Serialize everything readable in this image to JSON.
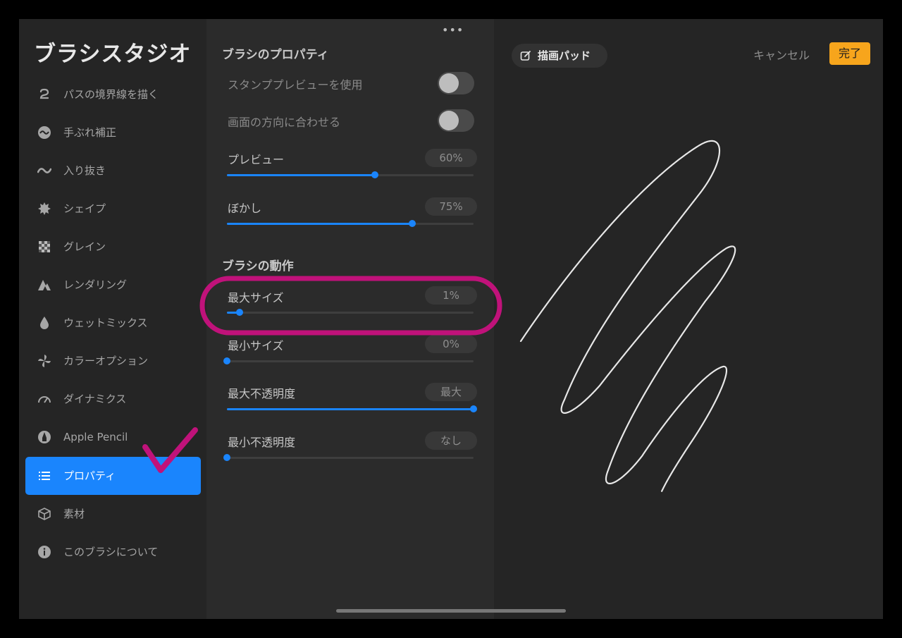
{
  "sidebar": {
    "title": "ブラシスタジオ",
    "items": [
      {
        "label": "パスの境界線を描く",
        "icon": "stroke-path-icon"
      },
      {
        "label": "手ぶれ補正",
        "icon": "stabilization-icon"
      },
      {
        "label": "入り抜き",
        "icon": "taper-icon"
      },
      {
        "label": "シェイプ",
        "icon": "shape-icon"
      },
      {
        "label": "グレイン",
        "icon": "grain-icon"
      },
      {
        "label": "レンダリング",
        "icon": "rendering-icon"
      },
      {
        "label": "ウェットミックス",
        "icon": "wet-mix-icon"
      },
      {
        "label": "カラーオプション",
        "icon": "color-options-icon"
      },
      {
        "label": "ダイナミクス",
        "icon": "dynamics-icon"
      },
      {
        "label": "Apple Pencil",
        "icon": "apple-pencil-icon"
      },
      {
        "label": "プロパティ",
        "icon": "properties-icon",
        "active": true
      },
      {
        "label": "素材",
        "icon": "materials-icon"
      },
      {
        "label": "このブラシについて",
        "icon": "info-icon"
      }
    ]
  },
  "panel": {
    "more_menu": "•••",
    "section1_title": "ブラシのプロパティ",
    "stamp_preview": {
      "label": "スタンププレビューを使用",
      "on": false
    },
    "orient_screen": {
      "label": "画面の方向に合わせる",
      "on": false
    },
    "preview": {
      "label": "プレビュー",
      "value": "60%",
      "fraction": 0.6
    },
    "blur": {
      "label": "ぼかし",
      "value": "75%",
      "fraction": 0.75
    },
    "section2_title": "ブラシの動作",
    "max_size": {
      "label": "最大サイズ",
      "value": "1%",
      "fraction": 0.05
    },
    "min_size": {
      "label": "最小サイズ",
      "value": "0%",
      "fraction": 0.0
    },
    "max_opacity": {
      "label": "最大不透明度",
      "value": "最大",
      "fraction": 1.0
    },
    "min_opacity": {
      "label": "最小不透明度",
      "value": "なし",
      "fraction": 0.0
    }
  },
  "canvas": {
    "pad_label": "描画パッド",
    "cancel": "キャンセル",
    "done": "完了"
  },
  "colors": {
    "accent": "#1a85fd",
    "done_button": "#f7a51c",
    "annotation": "#c0127a"
  }
}
